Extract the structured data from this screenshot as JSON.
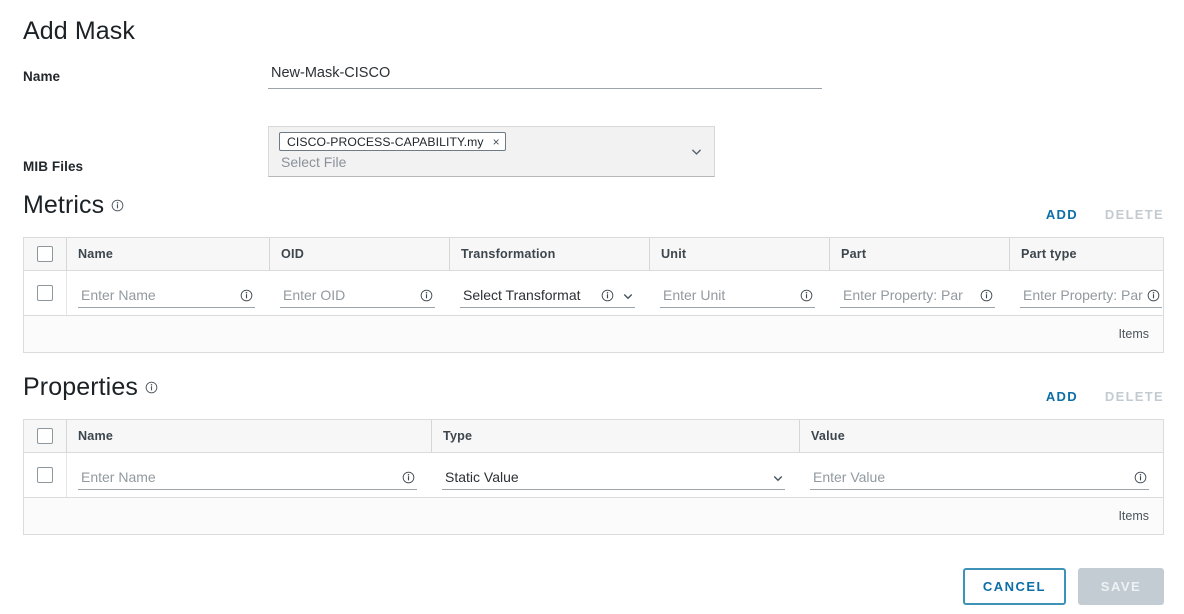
{
  "page": {
    "title": "Add Mask"
  },
  "name_field": {
    "label": "Name",
    "value": "New-Mask-CISCO",
    "placeholder": "Enter Name"
  },
  "mib_files": {
    "label": "MIB Files",
    "chip": "CISCO-PROCESS-CAPABILITY.my",
    "chip_remove": "×",
    "placeholder": "Select File",
    "caret_icon": "chevron-down-icon"
  },
  "metrics": {
    "title": "Metrics",
    "info_icon": "info-icon",
    "add_label": "ADD",
    "delete_label": "DELETE",
    "columns": [
      "Name",
      "OID",
      "Transformation",
      "Unit",
      "Part",
      "Part type"
    ],
    "rows": [
      {
        "name": "Enter Name",
        "oid": "Enter OID",
        "transformation": "Select Transformat",
        "unit": "Enter Unit",
        "part": "Enter Property: Par",
        "part_type": "Enter Property: Par"
      }
    ],
    "footer_label": "Items"
  },
  "properties": {
    "title": "Properties",
    "info_icon": "info-icon",
    "add_label": "ADD",
    "delete_label": "DELETE",
    "columns": [
      "Name",
      "Type",
      "Value"
    ],
    "rows": [
      {
        "name": "Enter Name",
        "type": "Static Value",
        "value": "Enter Value"
      }
    ],
    "footer_label": "Items"
  },
  "footer": {
    "cancel_label": "CANCEL",
    "save_label": "SAVE"
  },
  "colors": {
    "accent_link": "#0d6ea8",
    "disabled": "#c3cbd1",
    "text": "#22272b",
    "placeholder": "#929a9f",
    "border": "#dbdbdb",
    "header_bg": "#f7f7f7"
  }
}
